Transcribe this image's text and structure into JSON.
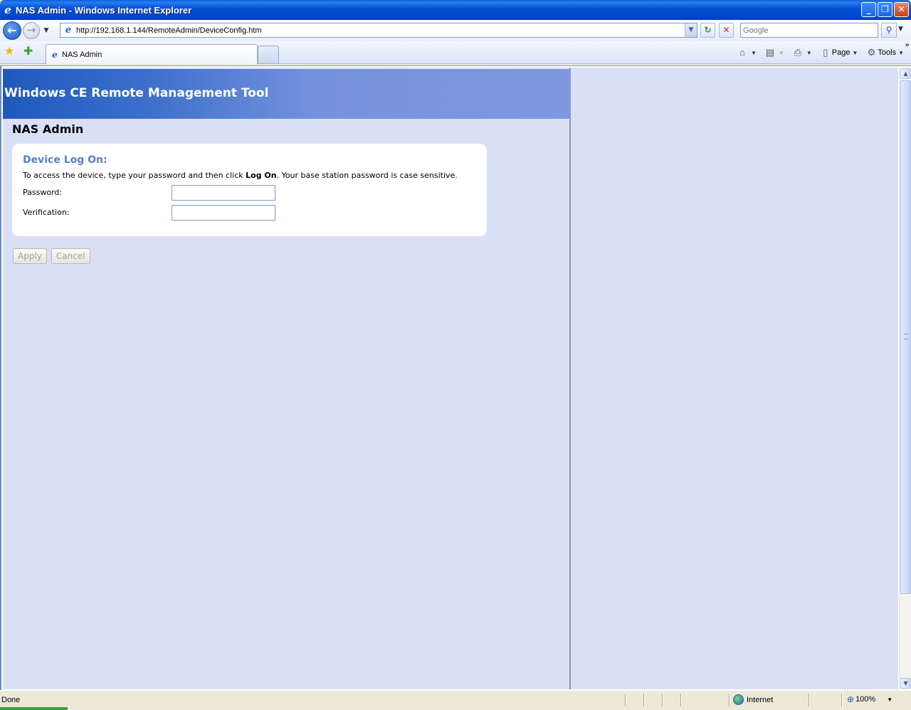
{
  "window": {
    "title": "NAS Admin - Windows Internet Explorer",
    "minimize": "_",
    "restore": "❐",
    "close": "✕"
  },
  "nav": {
    "back_glyph": "←",
    "forward_glyph": "→",
    "history_glyph": "▼",
    "address_url": "http://192.168.1.144/RemoteAdmin/DeviceConfig.htm",
    "address_drop_glyph": "▼",
    "refresh_glyph": "↻",
    "stop_glyph": "✕",
    "search_placeholder": "Google",
    "search_glyph": "⚲"
  },
  "tabs": {
    "active_label": "NAS Admin"
  },
  "command_bar": {
    "page_label": "Page",
    "tools_label": "Tools",
    "chevrons": "»"
  },
  "content": {
    "banner_title": "Windows CE Remote Management Tool",
    "page_heading": "NAS Admin",
    "card_title": "Device Log On:",
    "desc_before": "To access the device, type your password and then click ",
    "desc_bold": "Log On",
    "desc_after": ". Your base station password is case sensitive.",
    "password_label": "Password:",
    "verification_label": "Verification:",
    "password_value": "",
    "verification_value": "",
    "apply_label": "Apply",
    "cancel_label": "Cancel"
  },
  "status": {
    "text": "Done",
    "zone": "Internet",
    "zoom": "100%"
  },
  "icons": {
    "ie": "ie-logo-icon",
    "favorites": "favorites-star-icon",
    "add_favorites": "add-favorites-icon",
    "home": "home-icon",
    "feeds": "feeds-icon",
    "print": "print-icon",
    "page": "page-icon",
    "tools": "gear-icon",
    "globe": "globe-icon",
    "zoom": "magnifier-icon"
  }
}
